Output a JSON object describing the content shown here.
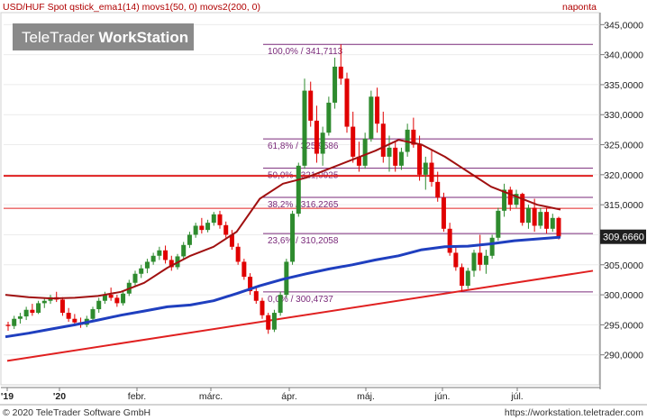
{
  "header": {
    "title": "USD/HUF Spot qstick_ema1(14) movs1(50, 0) movs2(200, 0)",
    "period": "naponta",
    "watermark_light": "TeleTrader",
    "watermark_bold": "WorkStation"
  },
  "footer": {
    "copyright": "© 2020 TeleTrader Software GmbH",
    "url": "https://workstation.teletrader.com"
  },
  "colors": {
    "up_candle": "#2e8b2e",
    "down_candle": "#e00000",
    "ma50": "#a01010",
    "ma200": "#1f3fbf",
    "fib": "#7a2a7a",
    "support_line": "#e02020",
    "horizontal_line": "#e02020",
    "last_price_bg": "#1f1f1f"
  },
  "chart_data": {
    "type": "candlestick",
    "title": "USD/HUF Spot qstick_ema1(14) movs1(50, 0) movs2(200, 0)",
    "ylim": [
      285.0,
      347.0
    ],
    "y_ticks": [
      "290,0000",
      "295,0000",
      "300,0000",
      "305,0000",
      "310,0000",
      "315,0000",
      "320,0000",
      "325,0000",
      "330,0000",
      "335,0000",
      "340,0000",
      "345,0000"
    ],
    "x_ticks": [
      "'19",
      "'20",
      "febr.",
      "márc.",
      "ápr.",
      "máj.",
      "jún.",
      "júl."
    ],
    "last_price": 309.666,
    "last_price_label": "309,6660",
    "fibonacci": [
      {
        "label": "100,0% / 341,7113",
        "value": 341.7113
      },
      {
        "label": "61,8% / 325,9586",
        "value": 325.9586
      },
      {
        "label": "50,0% / 321,0925",
        "value": 321.0925
      },
      {
        "label": "38,2% / 316,2265",
        "value": 316.2265
      },
      {
        "label": "23,6% / 310,2058",
        "value": 310.2058
      },
      {
        "label": "0,0% / 300,4737",
        "value": 300.4737
      }
    ],
    "horizontal_lines": [
      319.8,
      314.4
    ],
    "support_line": {
      "start": 289.0,
      "end": 304.0
    },
    "series": [
      {
        "name": "movs1(50, 0)",
        "values": [
          300.0,
          299.6,
          299.4,
          299.5,
          299.8,
          300.5,
          302.0,
          304.5,
          306.5,
          308.0,
          310.5,
          316.0,
          318.5,
          319.5,
          321.0,
          322.5,
          324.0,
          325.8,
          325.0,
          323.0,
          320.5,
          318.0,
          316.5,
          315.0,
          314.2
        ]
      },
      {
        "name": "movs2(200, 0)",
        "values": [
          293.0,
          293.6,
          294.3,
          295.0,
          295.8,
          296.6,
          297.3,
          298.0,
          298.3,
          299.0,
          300.2,
          301.5,
          302.6,
          303.5,
          304.3,
          305.0,
          305.8,
          306.5,
          307.5,
          308.0,
          308.1,
          308.5,
          309.0,
          309.3,
          309.6
        ]
      }
    ],
    "candles": [
      [
        295.0,
        295.5,
        294.0,
        294.8
      ],
      [
        294.8,
        296.5,
        294.3,
        296.0
      ],
      [
        296.0,
        297.0,
        295.2,
        296.4
      ],
      [
        296.4,
        298.0,
        295.8,
        297.5
      ],
      [
        297.5,
        298.5,
        296.5,
        297.0
      ],
      [
        297.0,
        299.0,
        296.8,
        298.6
      ],
      [
        298.6,
        299.5,
        297.8,
        299.0
      ],
      [
        299.0,
        300.0,
        298.5,
        299.6
      ],
      [
        299.6,
        300.5,
        298.8,
        299.2
      ],
      [
        299.2,
        299.6,
        296.5,
        297.0
      ],
      [
        297.0,
        297.8,
        295.5,
        296.0
      ],
      [
        296.0,
        296.8,
        294.8,
        295.4
      ],
      [
        295.4,
        296.2,
        294.5,
        295.0
      ],
      [
        295.0,
        296.5,
        294.6,
        296.0
      ],
      [
        296.0,
        298.0,
        295.5,
        297.6
      ],
      [
        297.6,
        299.5,
        297.0,
        299.0
      ],
      [
        299.0,
        300.5,
        298.5,
        300.0
      ],
      [
        300.0,
        301.2,
        299.0,
        299.5
      ],
      [
        299.5,
        300.0,
        298.0,
        298.6
      ],
      [
        298.6,
        300.5,
        298.2,
        300.2
      ],
      [
        300.2,
        302.5,
        299.8,
        302.0
      ],
      [
        302.0,
        304.0,
        301.5,
        303.5
      ],
      [
        303.5,
        305.0,
        302.8,
        304.4
      ],
      [
        304.4,
        306.0,
        303.6,
        305.5
      ],
      [
        305.5,
        307.0,
        305.0,
        306.5
      ],
      [
        306.5,
        308.0,
        305.8,
        307.4
      ],
      [
        307.4,
        308.2,
        305.2,
        305.8
      ],
      [
        305.8,
        306.5,
        304.0,
        304.6
      ],
      [
        304.6,
        306.8,
        304.2,
        306.4
      ],
      [
        306.4,
        308.8,
        306.0,
        308.3
      ],
      [
        308.3,
        310.5,
        307.8,
        310.0
      ],
      [
        310.0,
        312.0,
        309.5,
        311.5
      ],
      [
        311.5,
        312.8,
        310.2,
        310.8
      ],
      [
        310.8,
        312.5,
        310.4,
        312.0
      ],
      [
        312.0,
        313.8,
        311.5,
        313.4
      ],
      [
        313.4,
        314.0,
        311.0,
        311.6
      ],
      [
        311.6,
        312.2,
        309.5,
        310.0
      ],
      [
        310.0,
        310.8,
        307.5,
        308.0
      ],
      [
        308.0,
        308.6,
        305.0,
        305.5
      ],
      [
        305.5,
        306.0,
        302.5,
        303.0
      ],
      [
        303.0,
        303.6,
        300.0,
        300.6
      ],
      [
        300.6,
        301.2,
        298.5,
        299.0
      ],
      [
        299.0,
        299.5,
        296.0,
        296.6
      ],
      [
        296.6,
        297.0,
        293.5,
        294.2
      ],
      [
        294.2,
        297.5,
        293.8,
        297.0
      ],
      [
        297.0,
        300.5,
        296.5,
        300.0
      ],
      [
        300.0,
        306.0,
        299.5,
        305.5
      ],
      [
        305.5,
        314.0,
        305.0,
        313.5
      ],
      [
        313.5,
        322.0,
        313.0,
        321.5
      ],
      [
        321.5,
        336.0,
        321.0,
        334.0
      ],
      [
        334.0,
        335.5,
        328.0,
        329.0
      ],
      [
        329.0,
        331.5,
        322.0,
        323.5
      ],
      [
        323.5,
        328.0,
        321.5,
        327.0
      ],
      [
        327.0,
        333.0,
        326.5,
        332.0
      ],
      [
        332.0,
        339.5,
        331.0,
        338.0
      ],
      [
        338.0,
        341.7,
        335.0,
        336.0
      ],
      [
        336.0,
        337.0,
        327.0,
        328.0
      ],
      [
        328.0,
        330.5,
        322.0,
        323.0
      ],
      [
        323.0,
        325.5,
        320.5,
        321.5
      ],
      [
        321.5,
        327.0,
        321.0,
        326.0
      ],
      [
        326.0,
        334.0,
        325.5,
        333.0
      ],
      [
        333.0,
        334.5,
        327.0,
        328.5
      ],
      [
        328.5,
        330.5,
        322.0,
        323.0
      ],
      [
        323.0,
        326.5,
        320.5,
        324.5
      ],
      [
        324.5,
        325.5,
        320.5,
        321.5
      ],
      [
        321.5,
        324.5,
        320.8,
        323.8
      ],
      [
        323.8,
        328.5,
        323.0,
        327.5
      ],
      [
        327.5,
        329.5,
        324.5,
        325.0
      ],
      [
        325.0,
        326.5,
        319.0,
        320.0
      ],
      [
        320.0,
        323.0,
        317.5,
        322.0
      ],
      [
        322.0,
        324.0,
        318.0,
        318.8
      ],
      [
        318.8,
        320.5,
        315.5,
        316.2
      ],
      [
        316.2,
        317.0,
        310.5,
        311.0
      ],
      [
        311.0,
        312.0,
        306.5,
        307.0
      ],
      [
        307.0,
        308.0,
        304.0,
        304.6
      ],
      [
        304.6,
        305.2,
        300.5,
        301.5
      ],
      [
        301.5,
        304.5,
        301.0,
        304.0
      ],
      [
        304.0,
        307.5,
        303.0,
        307.0
      ],
      [
        307.0,
        310.0,
        304.0,
        305.0
      ],
      [
        305.0,
        307.5,
        303.5,
        306.5
      ],
      [
        306.5,
        310.0,
        306.0,
        309.5
      ],
      [
        309.5,
        314.5,
        309.0,
        314.0
      ],
      [
        314.0,
        318.5,
        313.0,
        317.5
      ],
      [
        317.5,
        318.0,
        314.0,
        315.0
      ],
      [
        315.0,
        317.5,
        314.5,
        316.8
      ],
      [
        316.8,
        317.0,
        311.5,
        312.0
      ],
      [
        312.0,
        315.0,
        311.0,
        314.5
      ],
      [
        314.5,
        316.0,
        310.5,
        311.5
      ],
      [
        311.5,
        314.5,
        311.0,
        313.8
      ],
      [
        313.8,
        314.5,
        310.2,
        311.0
      ],
      [
        311.0,
        313.5,
        310.5,
        312.8
      ],
      [
        312.8,
        313.0,
        309.2,
        309.7
      ]
    ]
  }
}
